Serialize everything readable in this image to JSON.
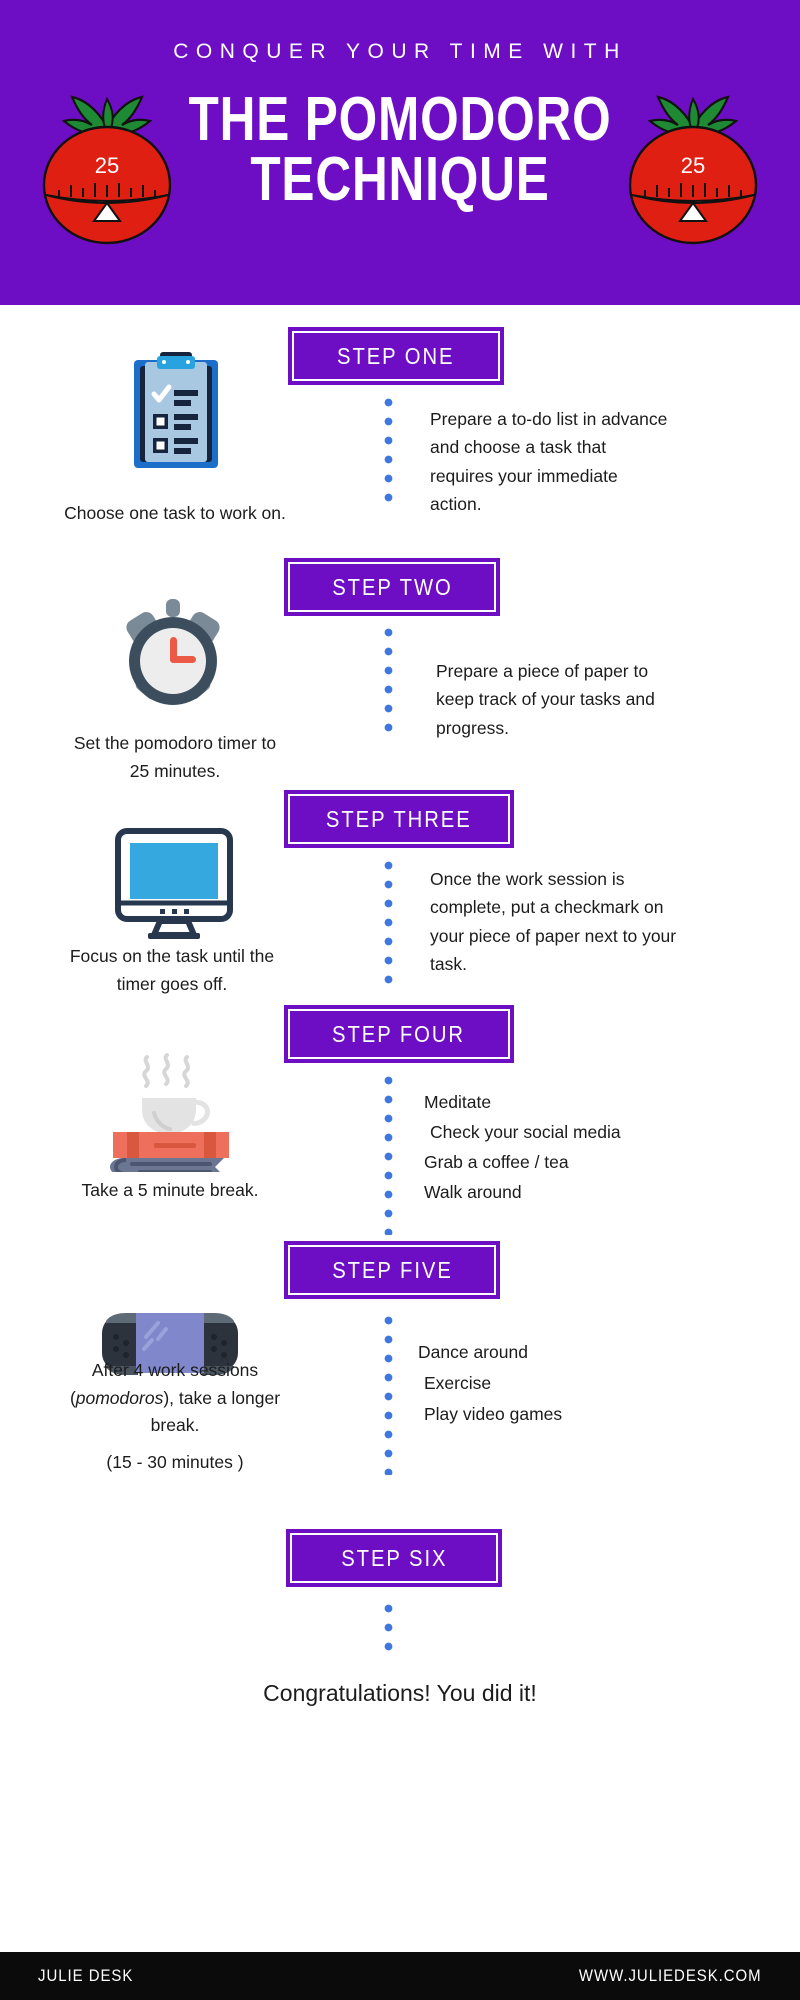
{
  "header": {
    "kicker": "CONQUER YOUR TIME WITH",
    "title_line1": "THE POMODORO",
    "title_line2": "TECHNIQUE",
    "purple": "#6D0EC4",
    "tomato_left_label": "25",
    "tomato_right_label": "25"
  },
  "steps": [
    {
      "badge": "STEP ONE",
      "icon": "clipboard-checklist-icon",
      "caption": "Choose one task to work on.",
      "detail": "Prepare a to-do list in advance and choose a task that requires your immediate action."
    },
    {
      "badge": "STEP TWO",
      "icon": "alarm-clock-icon",
      "caption_line1": "Set the pomodoro timer to",
      "caption_line2": "25 minutes.",
      "detail": "Prepare a piece of paper to keep track of your tasks and progress."
    },
    {
      "badge": "STEP THREE",
      "icon": "desktop-monitor-icon",
      "caption_line1": "Focus on the task until the",
      "caption_line2": "timer goes off.",
      "detail": "Once the work session is complete, put a checkmark on your piece of paper next to your task."
    },
    {
      "badge": "STEP FOUR",
      "icon": "coffee-on-books-icon",
      "caption": "Take a 5 minute break.",
      "list": [
        "Meditate",
        "Check your social media",
        "Grab a coffee / tea",
        "Walk around"
      ]
    },
    {
      "badge": "STEP FIVE",
      "icon": "handheld-game-console-icon",
      "caption_line1": "After 4 work sessions",
      "caption_line2_pre": "(",
      "caption_line2_em": "pomodoros",
      "caption_line2_post": "), take a longer",
      "caption_line3": "break.",
      "caption_line4": "(15 - 30 minutes )",
      "list": [
        "Dance around",
        "Exercise",
        "Play video games"
      ]
    },
    {
      "badge": "STEP SIX",
      "finale": "Congratulations! You did it!"
    }
  ],
  "footer": {
    "brand": "JULIE DESK",
    "url": "WWW.JULIEDESK.COM"
  },
  "colors": {
    "purple": "#6D0EC4",
    "dot_blue": "#3E78DE",
    "footer_bg": "#0b0b0b",
    "text": "#1c1c1c"
  }
}
